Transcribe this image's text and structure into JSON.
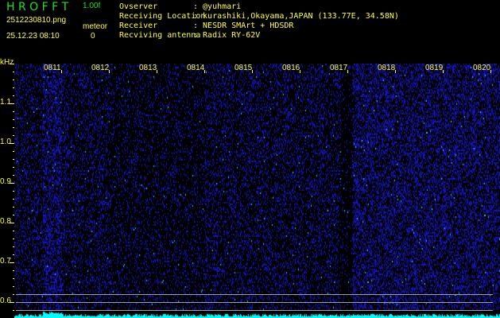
{
  "header": {
    "app_title": "H R O F F T",
    "version": "1.00f",
    "filename": "2512230810.png",
    "datetime": "25.12.23 08:10",
    "meteor_label": "meteor",
    "meteor_count": "0"
  },
  "info": [
    {
      "label": "Ovserver",
      "value": ": @yuhmari"
    },
    {
      "label": "Receiving Location",
      "value": ": kurashiki,Okayama,JAPAN (133.77E, 34.58N)"
    },
    {
      "label": "Receiver",
      "value": ": NESDR SMArt + HDSDR"
    },
    {
      "label": "Recviving antenna",
      "value": ": Radix RY-62V"
    }
  ],
  "axis": {
    "y_unit": "kHz",
    "y_ticks": [
      "1.1",
      "1.0",
      "0.9",
      "0.8",
      "0.7",
      "0.6"
    ],
    "x_ticks": [
      "0811",
      "0812",
      "0813",
      "0814",
      "0815",
      "0816",
      "0817",
      "0818",
      "0819",
      "0820"
    ]
  },
  "colors": {
    "background": "#000000",
    "text": "#ffff40",
    "title": "#20e020",
    "spectrum": "#2020ff",
    "signal": "#00ffff"
  }
}
